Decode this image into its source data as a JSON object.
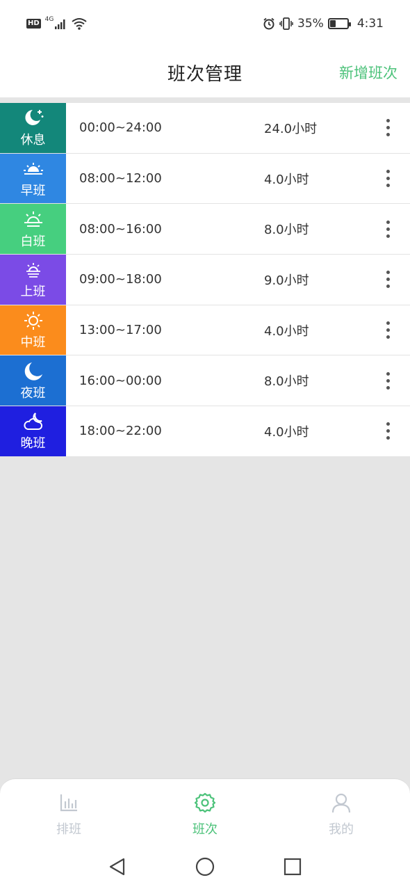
{
  "status_bar": {
    "hd": "HD",
    "network": "4G",
    "battery": "35%",
    "battery_level": 0.35,
    "time": "4:31"
  },
  "header": {
    "title": "班次管理",
    "action": "新增班次"
  },
  "shifts": [
    {
      "name": "休息",
      "time": "00:00~24:00",
      "hours": "24.0小时",
      "color": "#13877a",
      "icon": "moon-star-icon"
    },
    {
      "name": "早班",
      "time": "08:00~12:00",
      "hours": "4.0小时",
      "color": "#2f87e2",
      "icon": "sunrise-icon"
    },
    {
      "name": "白班",
      "time": "08:00~16:00",
      "hours": "8.0小时",
      "color": "#46cf7f",
      "icon": "sun-horizon-icon"
    },
    {
      "name": "上班",
      "time": "09:00~18:00",
      "hours": "9.0小时",
      "color": "#7b4be6",
      "icon": "sun-low-icon"
    },
    {
      "name": "中班",
      "time": "13:00~17:00",
      "hours": "4.0小时",
      "color": "#fb8c1c",
      "icon": "sun-icon"
    },
    {
      "name": "夜班",
      "time": "16:00~00:00",
      "hours": "8.0小时",
      "color": "#1c6fd2",
      "icon": "moon-icon"
    },
    {
      "name": "晚班",
      "time": "18:00~22:00",
      "hours": "4.0小时",
      "color": "#1f1fe0",
      "icon": "cloud-moon-icon"
    }
  ],
  "tabs": [
    {
      "label": "排班",
      "icon": "bar-chart-icon",
      "active": false
    },
    {
      "label": "班次",
      "icon": "gear-icon",
      "active": true
    },
    {
      "label": "我的",
      "icon": "user-icon",
      "active": false
    }
  ],
  "colors": {
    "accent": "#4cc27a",
    "inactive_tab": "#c2c8d0",
    "background": "#e5e5e5"
  }
}
